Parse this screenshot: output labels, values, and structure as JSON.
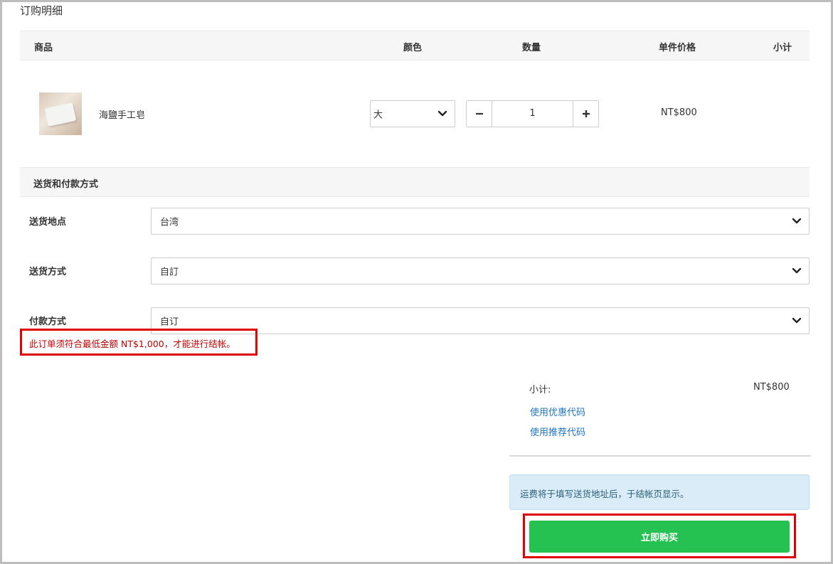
{
  "order": {
    "title": "订购明细",
    "columns": {
      "product": "商品",
      "color": "颜色",
      "quantity": "数量",
      "unit_price": "单件价格",
      "subtotal": "小计"
    },
    "item": {
      "name": "海鹽手工皂",
      "color_selected": "大",
      "quantity": "1",
      "unit_price": "NT$800"
    }
  },
  "shipping": {
    "title": "送货和付款方式",
    "location_label": "送货地点",
    "location_value": "台湾",
    "method_label": "送货方式",
    "method_value": "自訂",
    "payment_label": "付款方式",
    "payment_value": "自订",
    "error_message": "此订单须符合最低金额 NT$1,000，才能进行结帐。"
  },
  "summary": {
    "subtotal_label": "小计:",
    "subtotal_value": "NT$800",
    "coupon_link": "使用优惠代码",
    "referral_link": "使用推荐代码",
    "shipping_note": "运费将于填写送货地址后，于结帐页显示。",
    "buy_button": "立即购买"
  },
  "colors": {
    "buy_button": "#25c151",
    "error": "#c00000",
    "link": "#1f74c1",
    "info_bg": "#d9ecf7"
  },
  "icons": {
    "dropdown": "chevron-down-icon",
    "decrease": "minus-icon",
    "increase": "plus-icon"
  }
}
